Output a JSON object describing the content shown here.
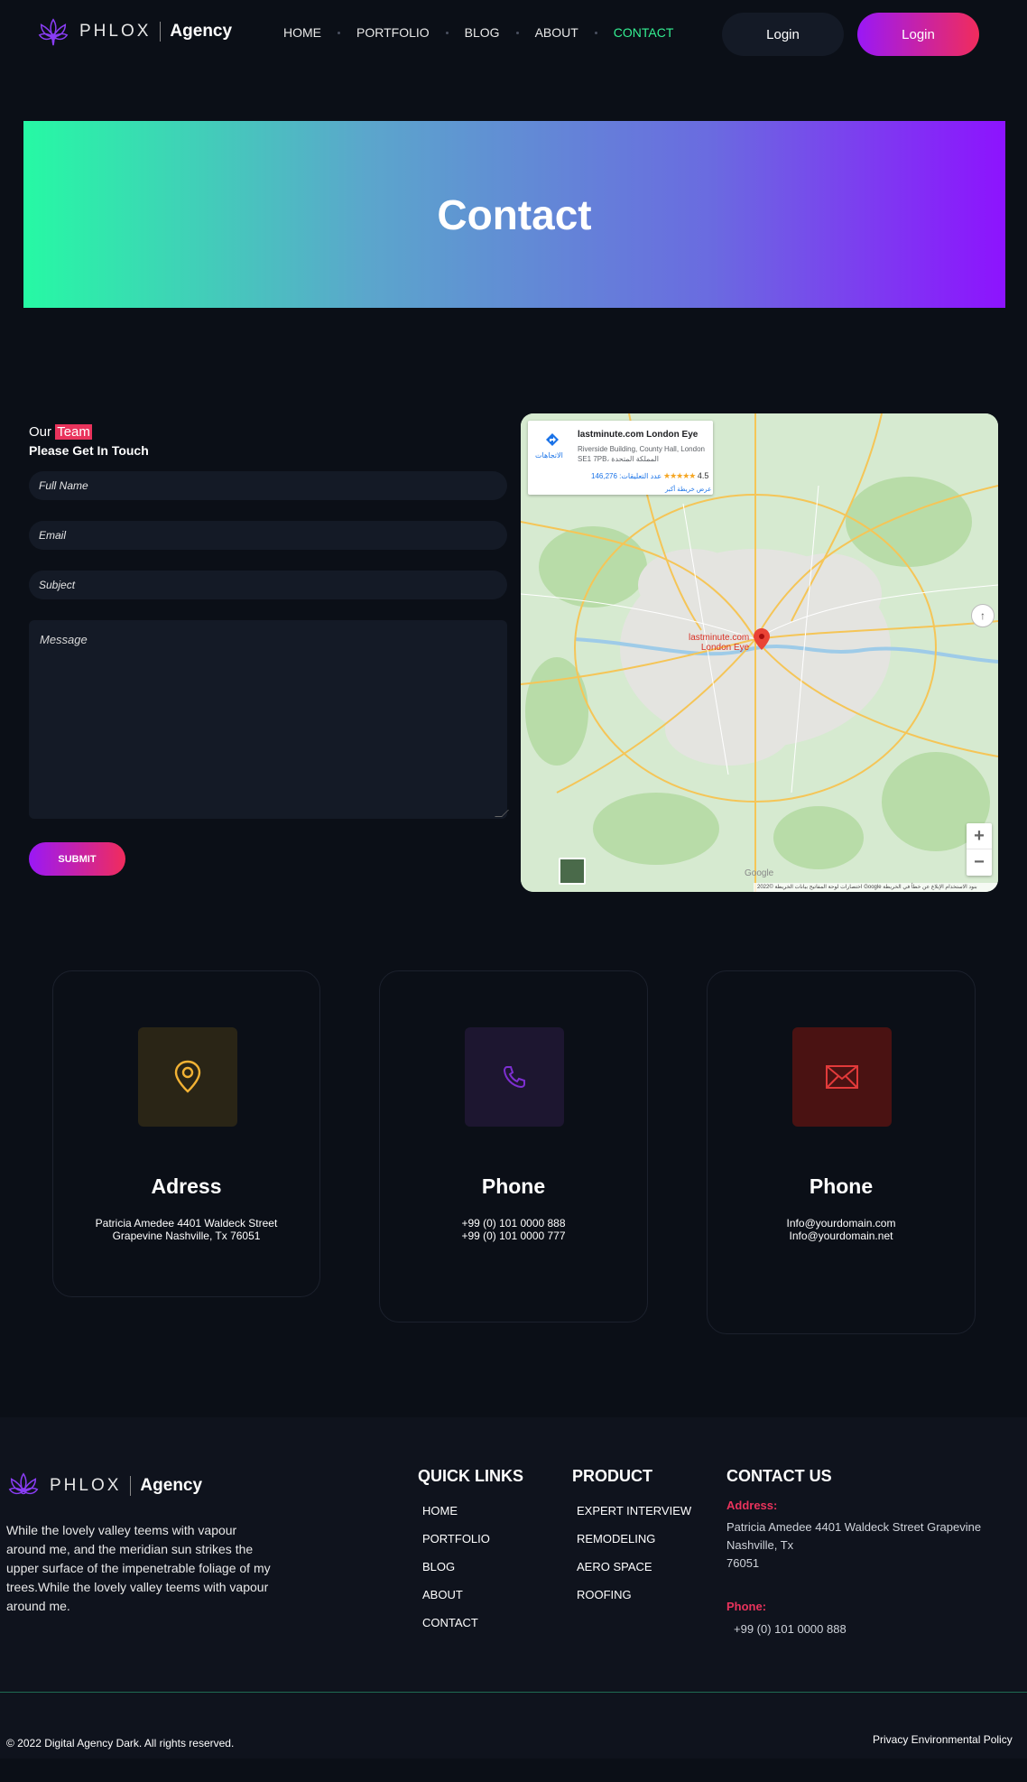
{
  "header": {
    "brand": "PHLOX",
    "agency": "Agency",
    "nav": [
      {
        "label": "HOME"
      },
      {
        "label": "PORTFOLIO"
      },
      {
        "label": "BLOG"
      },
      {
        "label": "ABOUT"
      },
      {
        "label": "CONTACT",
        "active": true
      }
    ],
    "login_primary": "Login",
    "login_secondary": "Login"
  },
  "hero": {
    "title": "Contact"
  },
  "form": {
    "intro_prefix": "Our",
    "intro_highlight": "Team",
    "subtitle": "Please Get In Touch",
    "full_name_placeholder": "Full Name",
    "email_placeholder": "Email",
    "subject_placeholder": "Subject",
    "message_placeholder": "Message",
    "submit_label": "SUBMIT"
  },
  "map": {
    "place_title": "lastminute.com London Eye",
    "place_address": "Riverside Building, County Hall, London SE1 7PB، المملكة المتحدة",
    "rating": "4.5",
    "stars": "★★★★★",
    "reviews": "عدد التعليقات: 146,276",
    "view_larger": "عرض خريطة أكبر",
    "directions": "الاتجاهات",
    "pin_label_line1": "lastminute.com",
    "pin_label_line2": "London Eye",
    "google": "Google",
    "footer_text": "اختصارات لوحة المفاتيح   بيانات الخريطة ©2022 Google   بنود الاستخدام   الإبلاغ عن خطأ في الخريطة",
    "zoom_in": "+",
    "zoom_out": "−"
  },
  "cards": [
    {
      "title": "Adress",
      "line1": "Patricia Amedee 4401 Waldeck Street",
      "line2": "Grapevine Nashville, Tx 76051",
      "icon": "location-pin-icon",
      "color": "#f2b234"
    },
    {
      "title": "Phone",
      "line1": "+99 (0) 101 0000 888",
      "line2": "+99 (0) 101 0000 777",
      "icon": "phone-icon",
      "color": "#7d2fd0"
    },
    {
      "title": "Phone",
      "line1": "Info@yourdomain.com",
      "line2": "Info@yourdomain.net",
      "icon": "envelope-icon",
      "color": "#e23a3a"
    }
  ],
  "footer": {
    "brand": "PHLOX",
    "agency": "Agency",
    "description": "While the lovely valley teems with vapour around me, and the meridian sun strikes the upper surface of the impenetrable foliage of my trees.While the lovely valley teems with vapour around me.",
    "quick_links_title": "QUICK LINKS",
    "quick_links": [
      "HOME",
      "PORTFOLIO",
      "BLOG",
      "ABOUT",
      "CONTACT"
    ],
    "product_title": "PRODUCT",
    "products": [
      "EXPERT INTERVIEW",
      "REMODELING",
      "AERO SPACE",
      "ROOFING"
    ],
    "contact_title": "CONTACT US",
    "address_label": "Address:",
    "address_line1": "Patricia Amedee 4401 Waldeck Street Grapevine",
    "address_line2": "Nashville, Tx",
    "address_line3": "76051",
    "phone_label": "Phone:",
    "phone_value": "+99 (0) 101 0000 888",
    "copyright": "© 2022 Digital Agency Dark. All rights reserved.",
    "policy": "Privacy Environmental Policy"
  },
  "colors": {
    "accent_green": "#34ef92",
    "accent_pink": "#e9335c",
    "accent_purple": "#9a18f6"
  }
}
